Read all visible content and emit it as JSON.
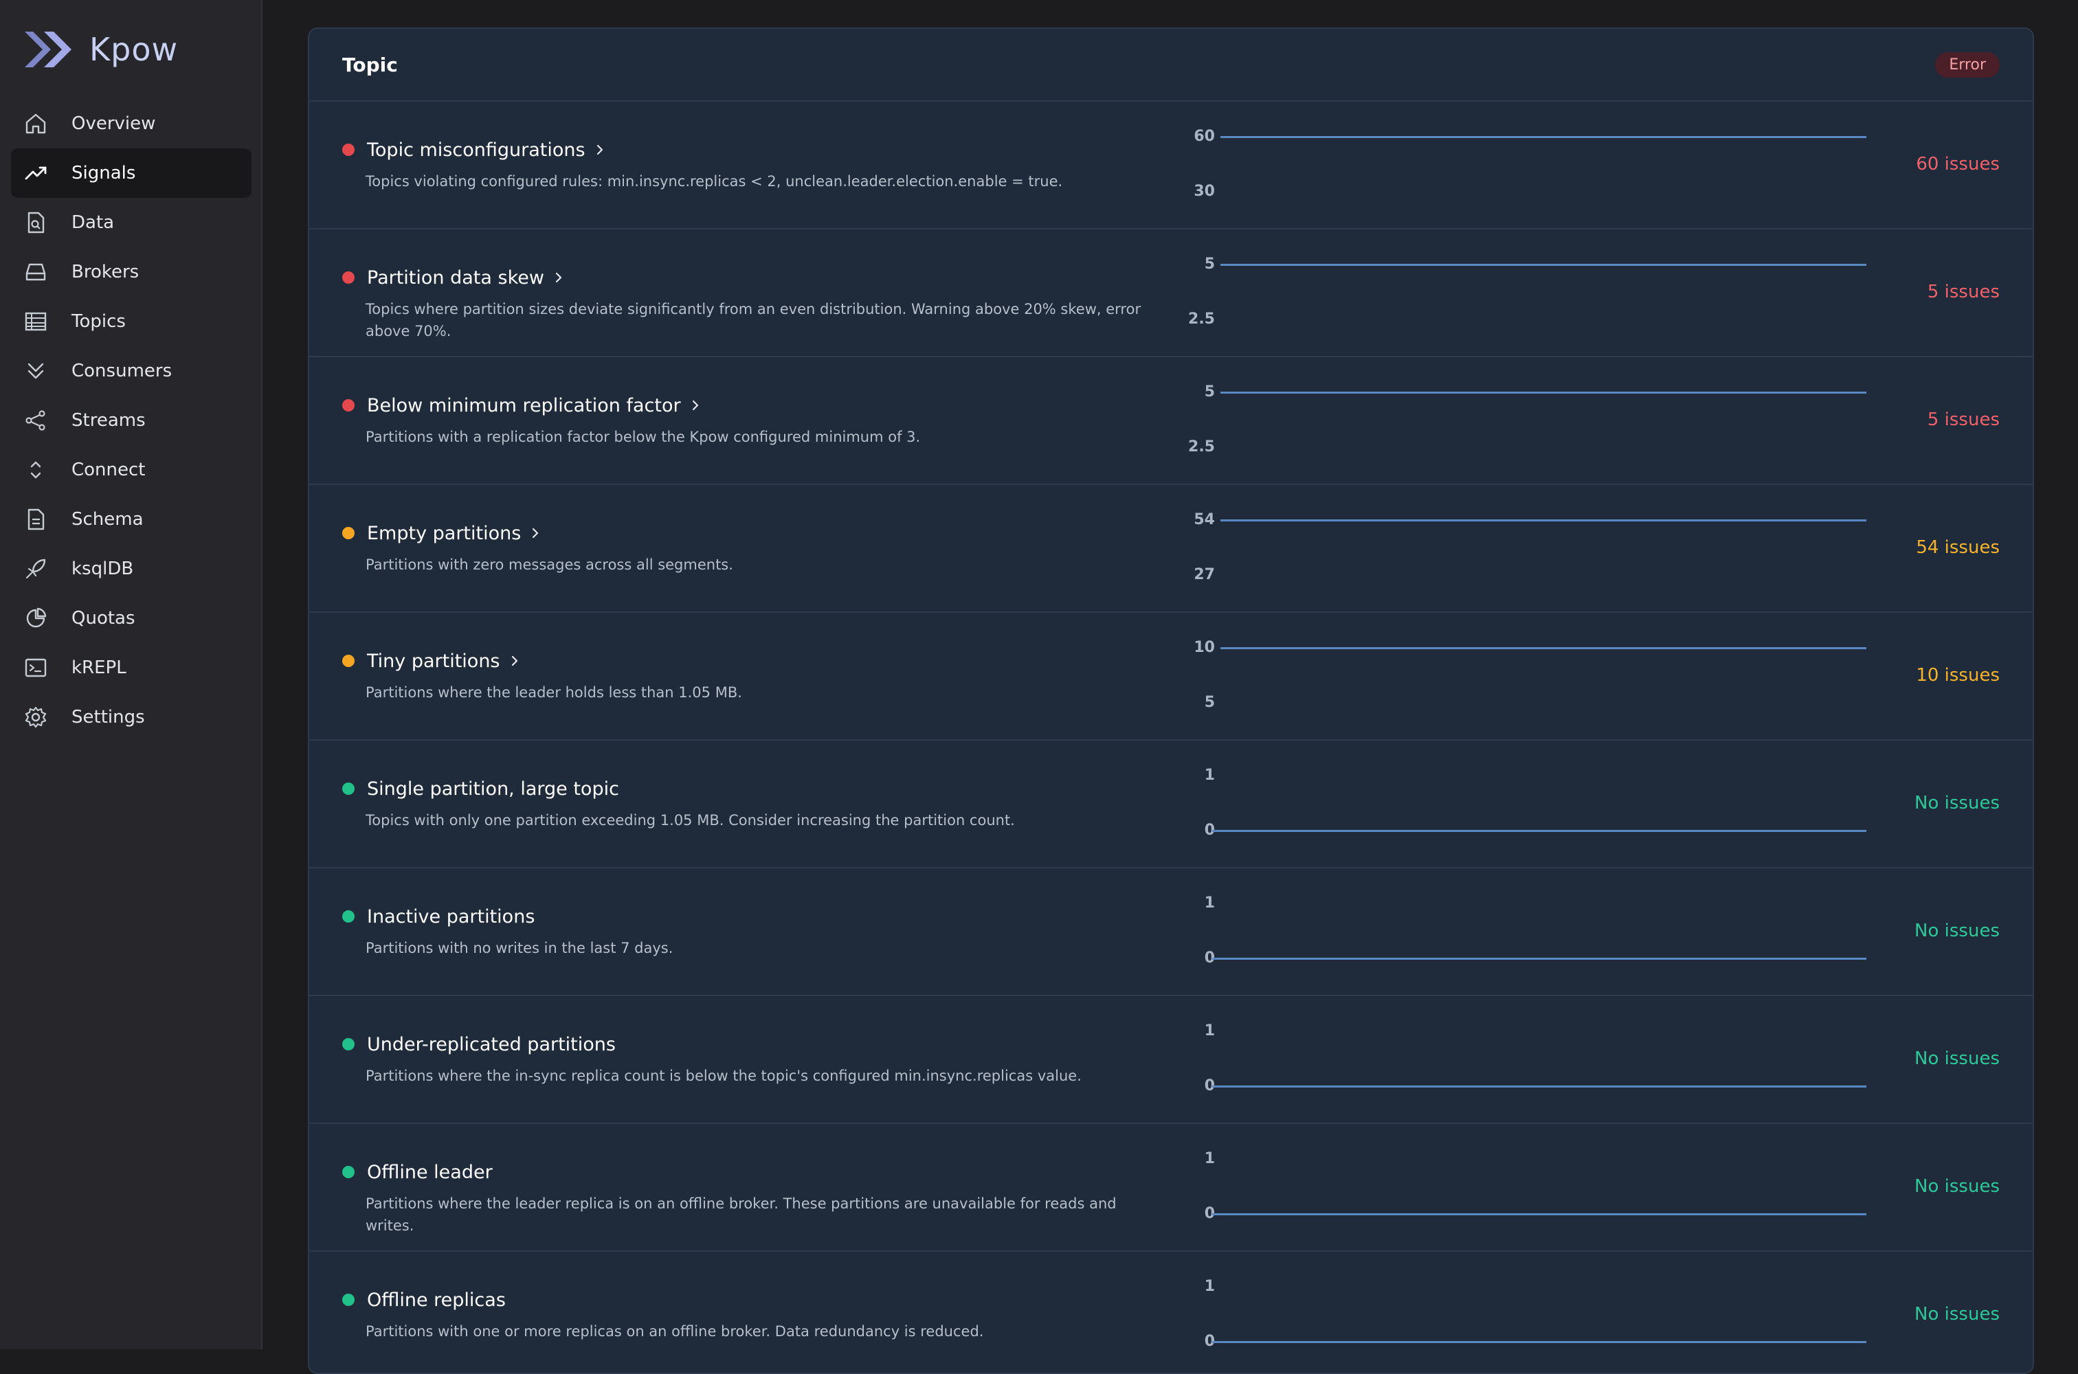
{
  "app": {
    "name": "Kpow",
    "brand_color": "#8c94d8"
  },
  "sidebar": {
    "items": [
      {
        "label": "Overview",
        "icon": "home-icon",
        "active": false
      },
      {
        "label": "Signals",
        "icon": "trending-up-icon",
        "active": true
      },
      {
        "label": "Data",
        "icon": "file-search-icon",
        "active": false
      },
      {
        "label": "Brokers",
        "icon": "hard-drive-icon",
        "active": false
      },
      {
        "label": "Topics",
        "icon": "table-icon",
        "active": false
      },
      {
        "label": "Consumers",
        "icon": "chevrons-down-icon",
        "active": false
      },
      {
        "label": "Streams",
        "icon": "share-icon",
        "active": false
      },
      {
        "label": "Connect",
        "icon": "chevrons-up-down-icon",
        "active": false
      },
      {
        "label": "Schema",
        "icon": "document-icon",
        "active": false
      },
      {
        "label": "ksqlDB",
        "icon": "rocket-icon",
        "active": false
      },
      {
        "label": "Quotas",
        "icon": "pie-chart-icon",
        "active": false
      },
      {
        "label": "kREPL",
        "icon": "terminal-icon",
        "active": false
      },
      {
        "label": "Settings",
        "icon": "gear-icon",
        "active": false
      }
    ]
  },
  "panel": {
    "title": "Topic",
    "status": "Error",
    "colors": {
      "error": "#e5484d",
      "warning": "#f5a623",
      "ok": "#22c08a",
      "error_text": "#f0616a",
      "warning_text": "#f7b32b",
      "ok_text": "#2ec99a",
      "line": "#5a8ac4"
    }
  },
  "signals": [
    {
      "title": "Topic misconfigurations",
      "desc": "Topics violating configured rules: min.insync.replicas < 2, unclean.leader.election.enable = true.",
      "severity": "error",
      "has_link": true,
      "tick_top": "60",
      "tick_bottom": "30",
      "value": 60,
      "issues": "60 issues"
    },
    {
      "title": "Partition data skew",
      "desc": "Topics where partition sizes deviate significantly from an even distribution. Warning above 20% skew, error above 70%.",
      "severity": "error",
      "has_link": true,
      "tick_top": "5",
      "tick_bottom": "2.5",
      "value": 5,
      "issues": "5 issues"
    },
    {
      "title": "Below minimum replication factor",
      "desc": "Partitions with a replication factor below the Kpow configured minimum of 3.",
      "severity": "error",
      "has_link": true,
      "tick_top": "5",
      "tick_bottom": "2.5",
      "value": 5,
      "issues": "5 issues"
    },
    {
      "title": "Empty partitions",
      "desc": "Partitions with zero messages across all segments.",
      "severity": "warning",
      "has_link": true,
      "tick_top": "54",
      "tick_bottom": "27",
      "value": 54,
      "issues": "54 issues"
    },
    {
      "title": "Tiny partitions",
      "desc": "Partitions where the leader holds less than 1.05 MB.",
      "severity": "warning",
      "has_link": true,
      "tick_top": "10",
      "tick_bottom": "5",
      "value": 10,
      "issues": "10 issues"
    },
    {
      "title": "Single partition, large topic",
      "desc": "Topics with only one partition exceeding 1.05 MB. Consider increasing the partition count.",
      "severity": "ok",
      "has_link": false,
      "tick_top": "1",
      "tick_bottom": "0",
      "value": 0,
      "issues": "No issues"
    },
    {
      "title": "Inactive partitions",
      "desc": "Partitions with no writes in the last 7 days.",
      "severity": "ok",
      "has_link": false,
      "tick_top": "1",
      "tick_bottom": "0",
      "value": 0,
      "issues": "No issues"
    },
    {
      "title": "Under-replicated partitions",
      "desc": "Partitions where the in-sync replica count is below the topic's configured min.insync.replicas value.",
      "severity": "ok",
      "has_link": false,
      "tick_top": "1",
      "tick_bottom": "0",
      "value": 0,
      "issues": "No issues"
    },
    {
      "title": "Offline leader",
      "desc": "Partitions where the leader replica is on an offline broker. These partitions are unavailable for reads and writes.",
      "severity": "ok",
      "has_link": false,
      "tick_top": "1",
      "tick_bottom": "0",
      "value": 0,
      "issues": "No issues"
    },
    {
      "title": "Offline replicas",
      "desc": "Partitions with one or more replicas on an offline broker. Data redundancy is reduced.",
      "severity": "ok",
      "has_link": false,
      "tick_top": "1",
      "tick_bottom": "0",
      "value": 0,
      "issues": "No issues"
    }
  ]
}
